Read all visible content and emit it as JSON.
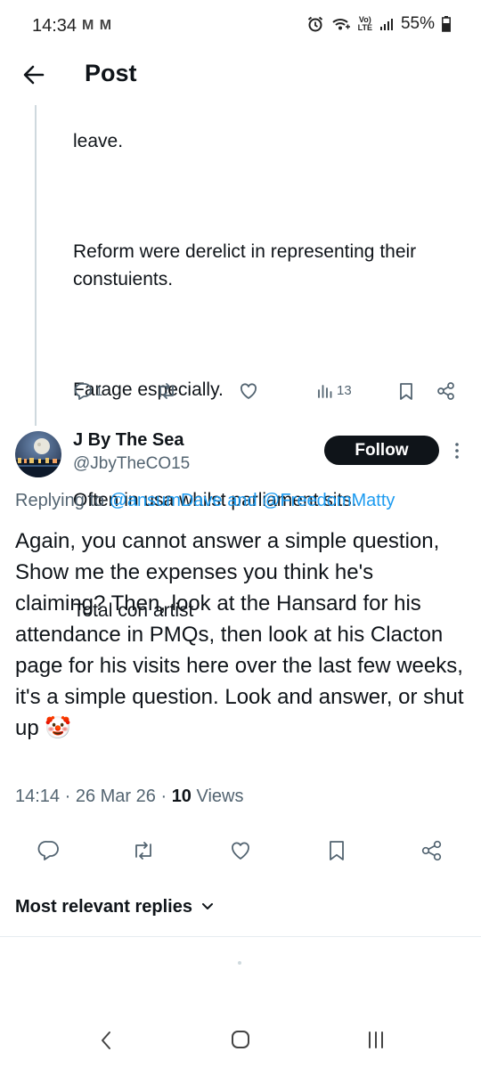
{
  "status_bar": {
    "time": "14:34",
    "notif_icons": "M M",
    "battery": "55%",
    "volte": "Vo)",
    "lte": "LTE"
  },
  "header": {
    "title": "Post"
  },
  "upper_tweet": {
    "paragraphs": [
      "leave.",
      "Reform were derelict in representing their constuients.",
      "Farage especially.",
      "Often in usa whilst parliament sits.",
      "Total con artist"
    ],
    "reply_count": "1",
    "views_count": "13"
  },
  "main_tweet": {
    "display_name": "J By The Sea",
    "handle": "@JbyTheCO15",
    "follow_label": "Follow",
    "replying_prefix": "Replying to",
    "mention_1": "@ansumDave",
    "replying_and": "and",
    "mention_2": "@FreedomMatty",
    "body": "Again, you cannot answer a simple question, Show me the expenses you think he's claiming? Then, look at the Hansard for his attendance in PMQs, then look at his Clacton page for his visits here over the last few weeks, it's a simple question. Look and answer, or shut up 🤡",
    "time": "14:14",
    "date": "26 Mar 26",
    "views_number": "10",
    "views_label": "Views"
  },
  "replies": {
    "sort_label": "Most relevant replies"
  },
  "colors": {
    "text": "#0f1419",
    "secondary": "#536471",
    "link": "#1d9bf0",
    "follow_bg": "#0f1419"
  }
}
